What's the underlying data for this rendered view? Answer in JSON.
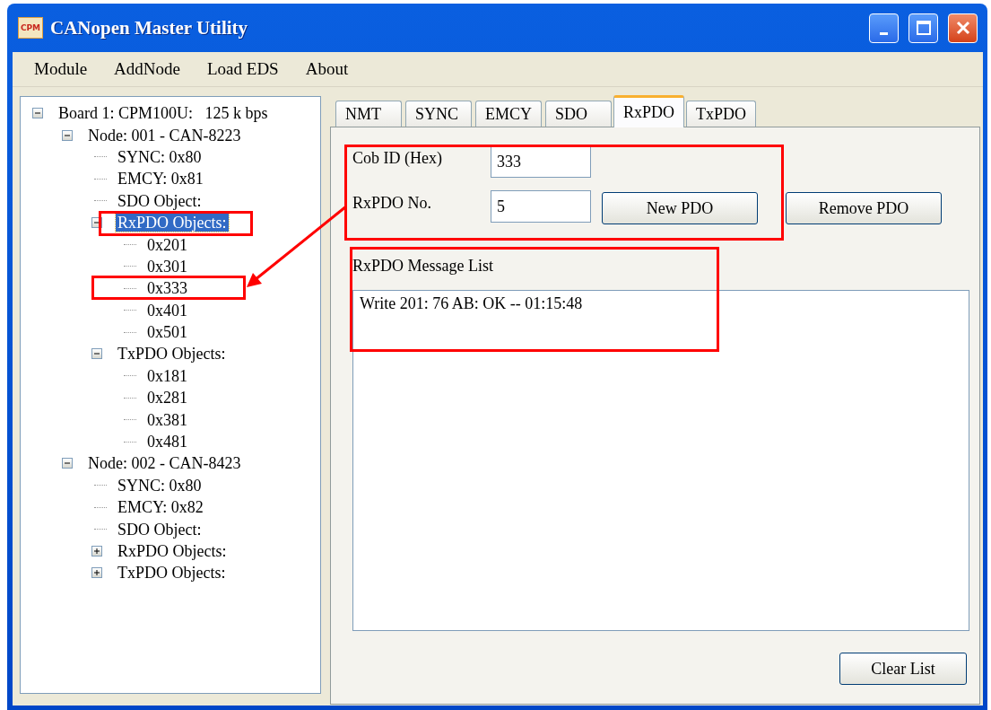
{
  "window": {
    "title": "CANopen Master Utility",
    "icon_label": "CPM"
  },
  "menu": [
    "Module",
    "AddNode",
    "Load EDS",
    "About"
  ],
  "tree": [
    {
      "label": "Board 1: CPM100U:   125 k bps",
      "expanded": true,
      "selected": false,
      "children": [
        {
          "label": "Node: 001 - CAN-8223",
          "expanded": true,
          "selected": false,
          "children": [
            {
              "label": "SYNC: 0x80",
              "selected": false
            },
            {
              "label": "EMCY: 0x81",
              "selected": false
            },
            {
              "label": "SDO Object:",
              "selected": false
            },
            {
              "label": "RxPDO Objects:",
              "expanded": true,
              "selected": true,
              "children": [
                {
                  "label": "0x201",
                  "selected": false
                },
                {
                  "label": "0x301",
                  "selected": false
                },
                {
                  "label": "0x333",
                  "selected": false
                },
                {
                  "label": "0x401",
                  "selected": false
                },
                {
                  "label": "0x501",
                  "selected": false
                }
              ]
            },
            {
              "label": "TxPDO Objects:",
              "expanded": true,
              "selected": false,
              "children": [
                {
                  "label": "0x181",
                  "selected": false
                },
                {
                  "label": "0x281",
                  "selected": false
                },
                {
                  "label": "0x381",
                  "selected": false
                },
                {
                  "label": "0x481",
                  "selected": false
                }
              ]
            }
          ]
        },
        {
          "label": "Node: 002 - CAN-8423",
          "expanded": true,
          "selected": false,
          "children": [
            {
              "label": "SYNC: 0x80",
              "selected": false
            },
            {
              "label": "EMCY: 0x82",
              "selected": false
            },
            {
              "label": "SDO Object:",
              "selected": false
            },
            {
              "label": "RxPDO Objects:",
              "expanded": false,
              "selected": false
            },
            {
              "label": "TxPDO Objects:",
              "expanded": false,
              "selected": false
            }
          ]
        }
      ]
    }
  ],
  "tabs": [
    {
      "label": "NMT",
      "selected": false
    },
    {
      "label": "SYNC",
      "selected": false
    },
    {
      "label": "EMCY",
      "selected": false
    },
    {
      "label": "SDO",
      "selected": false
    },
    {
      "label": "RxPDO",
      "selected": true
    },
    {
      "label": "TxPDO",
      "selected": false
    }
  ],
  "rxpdo": {
    "cob_id": {
      "label": "Cob ID (Hex)",
      "value": "333"
    },
    "pdo_no": {
      "label": "RxPDO No.",
      "value": "5"
    },
    "new_button": "New PDO",
    "remove_button": "Remove PDO",
    "list_title": "RxPDO Message List",
    "messages": [
      "Write 201: 76 AB: OK -- 01:15:48"
    ],
    "clear_button": "Clear List"
  }
}
